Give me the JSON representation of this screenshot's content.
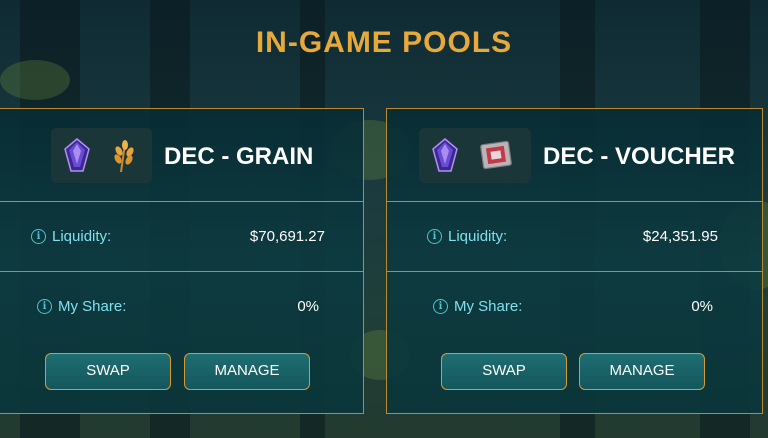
{
  "page": {
    "title": "IN-GAME POOLS"
  },
  "pools": [
    {
      "name": "DEC - GRAIN",
      "token_icons": [
        "dec-crystal-icon",
        "grain-wheat-icon"
      ],
      "liquidity_label": "Liquidity:",
      "liquidity_value": "$70,691.27",
      "share_label": "My Share:",
      "share_value": "0%",
      "swap_label": "SWAP",
      "manage_label": "MANAGE"
    },
    {
      "name": "DEC - VOUCHER",
      "token_icons": [
        "dec-crystal-icon",
        "voucher-ticket-icon"
      ],
      "liquidity_label": "Liquidity:",
      "liquidity_value": "$24,351.95",
      "share_label": "My Share:",
      "share_value": "0%",
      "swap_label": "SWAP",
      "manage_label": "MANAGE"
    }
  ],
  "colors": {
    "accent_gold": "#e7a93a",
    "border_gold": "#b98a32",
    "label_cyan": "#7fe0ec",
    "info_icon": "#4fc3d1",
    "card_bg": "#0c3a40",
    "button_bg": "#1e6e72"
  }
}
